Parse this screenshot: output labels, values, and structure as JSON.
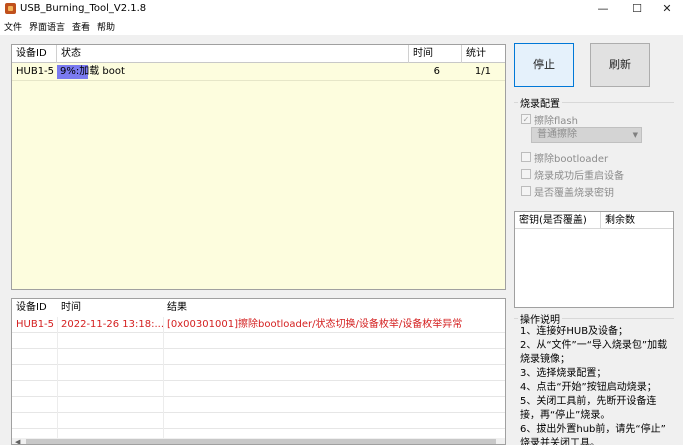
{
  "window": {
    "title": "USB_Burning_Tool_V2.1.8",
    "min": "—",
    "max": "☐",
    "close": "✕"
  },
  "menu": [
    "文件",
    "界面语言",
    "查看",
    "帮助"
  ],
  "main_table": {
    "headers": [
      "设备ID",
      "状态",
      "时间",
      "统计"
    ],
    "rows": [
      {
        "device": "HUB1-5",
        "status": "9%:加载 boot",
        "progress_percent": 9,
        "time": "6",
        "stat": "1/1"
      }
    ]
  },
  "log_table": {
    "headers": [
      "设备ID",
      "时间",
      "结果"
    ],
    "rows": [
      {
        "device": "HUB1-5",
        "time": "2022-11-26 13:18:...",
        "result": "[0x00301001]擦除bootloader/状态切换/设备枚举/设备枚举异常"
      }
    ]
  },
  "buttons": {
    "stop": "停止",
    "refresh": "刷新"
  },
  "config": {
    "title": "烧录配置",
    "erase_flash": "擦除flash",
    "erase_flash_checked": true,
    "erase_mode": "普通擦除",
    "erase_bootloader": "擦除bootloader",
    "reboot_after": "烧录成功后重启设备",
    "overwrite_key": "是否覆盖烧录密钥"
  },
  "key_list": {
    "headers": [
      "密钥(是否覆盖)",
      "剩余数"
    ]
  },
  "instructions": {
    "title": "操作说明",
    "lines": [
      "1、连接好HUB及设备；",
      "2、从“文件”一“导入烧录包”加载",
      "烧录镜像；",
      "3、选择烧录配置；",
      "4、点击“开始”按钮启动烧录；",
      "5、关闭工具前，先断开设备连",
      "接，再“停止”烧录。",
      "6、拔出外置hub前，请先“停止”",
      "烧录并关闭工具。"
    ]
  },
  "colors": {
    "table_bg": "#fdfdde",
    "progress": "#7b7bf0",
    "error_text": "#d42020"
  }
}
